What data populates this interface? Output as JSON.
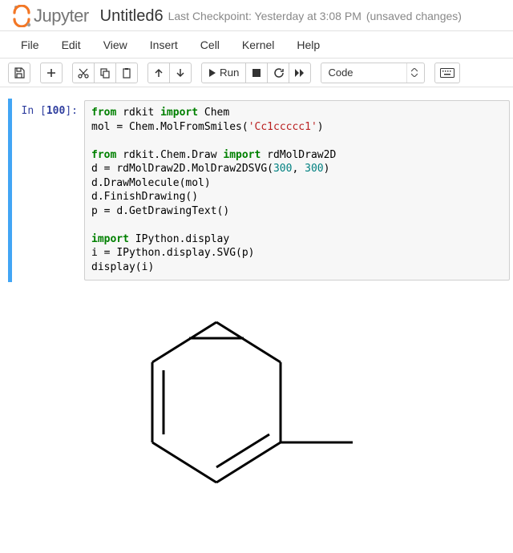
{
  "header": {
    "logo_text": "Jupyter",
    "title": "Untitled6",
    "checkpoint": "Last Checkpoint: Yesterday at 3:08 PM",
    "unsaved": "(unsaved changes)"
  },
  "menu": {
    "file": "File",
    "edit": "Edit",
    "view": "View",
    "insert": "Insert",
    "cell": "Cell",
    "kernel": "Kernel",
    "help": "Help"
  },
  "toolbar": {
    "run_label": "Run",
    "cell_type_selected": "Code"
  },
  "cell": {
    "prompt_prefix": "In [",
    "prompt_num": "100",
    "prompt_suffix": "]:",
    "code_tokens": [
      {
        "t": "kw",
        "v": "from"
      },
      {
        "t": "sp",
        "v": " "
      },
      {
        "t": "nm",
        "v": "rdkit"
      },
      {
        "t": "sp",
        "v": " "
      },
      {
        "t": "kw",
        "v": "import"
      },
      {
        "t": "sp",
        "v": " "
      },
      {
        "t": "nm",
        "v": "Chem"
      },
      {
        "t": "nl"
      },
      {
        "t": "nm",
        "v": "mol"
      },
      {
        "t": "sp",
        "v": " "
      },
      {
        "t": "py-op",
        "v": "="
      },
      {
        "t": "sp",
        "v": " "
      },
      {
        "t": "nm",
        "v": "Chem.MolFromSmiles("
      },
      {
        "t": "str",
        "v": "'Cc1ccccc1'"
      },
      {
        "t": "nm",
        "v": ")"
      },
      {
        "t": "nl"
      },
      {
        "t": "nl"
      },
      {
        "t": "kw",
        "v": "from"
      },
      {
        "t": "sp",
        "v": " "
      },
      {
        "t": "nm",
        "v": "rdkit.Chem.Draw"
      },
      {
        "t": "sp",
        "v": " "
      },
      {
        "t": "kw",
        "v": "import"
      },
      {
        "t": "sp",
        "v": " "
      },
      {
        "t": "nm",
        "v": "rdMolDraw2D"
      },
      {
        "t": "nl"
      },
      {
        "t": "nm",
        "v": "d"
      },
      {
        "t": "sp",
        "v": " "
      },
      {
        "t": "py-op",
        "v": "="
      },
      {
        "t": "sp",
        "v": " "
      },
      {
        "t": "nm",
        "v": "rdMolDraw2D.MolDraw2DSVG("
      },
      {
        "t": "num",
        "v": "300"
      },
      {
        "t": "nm",
        "v": ", "
      },
      {
        "t": "num",
        "v": "300"
      },
      {
        "t": "nm",
        "v": ")"
      },
      {
        "t": "nl"
      },
      {
        "t": "nm",
        "v": "d.DrawMolecule(mol)"
      },
      {
        "t": "nl"
      },
      {
        "t": "nm",
        "v": "d.FinishDrawing()"
      },
      {
        "t": "nl"
      },
      {
        "t": "nm",
        "v": "p"
      },
      {
        "t": "sp",
        "v": " "
      },
      {
        "t": "py-op",
        "v": "="
      },
      {
        "t": "sp",
        "v": " "
      },
      {
        "t": "nm",
        "v": "d.GetDrawingText()"
      },
      {
        "t": "nl"
      },
      {
        "t": "nl"
      },
      {
        "t": "kw",
        "v": "import"
      },
      {
        "t": "sp",
        "v": " "
      },
      {
        "t": "nm",
        "v": "IPython.display"
      },
      {
        "t": "nl"
      },
      {
        "t": "nm",
        "v": "i"
      },
      {
        "t": "sp",
        "v": " "
      },
      {
        "t": "py-op",
        "v": "="
      },
      {
        "t": "sp",
        "v": " "
      },
      {
        "t": "nm",
        "v": "IPython.display.SVG(p)"
      },
      {
        "t": "nl"
      },
      {
        "t": "nm",
        "v": "display(i)"
      }
    ]
  }
}
